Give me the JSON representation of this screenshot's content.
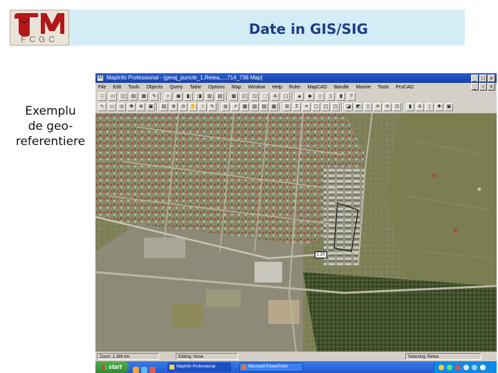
{
  "header": {
    "logo_text": "TM",
    "logo_subtext": "FCGC",
    "title": "Date in GIS/SIG"
  },
  "caption": {
    "lines": [
      "Exemplu",
      "de geo-",
      "referentiere"
    ]
  },
  "window": {
    "title": "MapInfo Professional - [geraj_puncte_1.Retea,...,714_736 Map]",
    "menu": [
      "File",
      "Edit",
      "Tools",
      "Objects",
      "Query",
      "Table",
      "Options",
      "Map",
      "Window",
      "Help",
      "Ruler",
      "MapCAD",
      "Bandle",
      "Marine",
      "Tools",
      "ProCAD"
    ],
    "scale_label": "1:20",
    "status": {
      "zoom": "Zoom: 1.188 km",
      "editing": "Editing: None",
      "selecting": "Selecting: Retea"
    }
  },
  "taskbar": {
    "start_label": "start",
    "tasks": [
      "MapInfo Professional",
      "Microsoft PowerPoint"
    ]
  },
  "colors": {
    "title_bar_bg": "#d3ecf5",
    "title_text": "#1f3a8a",
    "logo_red": "#b3171a",
    "xp_blue": "#245ad3",
    "start_green": "#2f8a2f"
  }
}
